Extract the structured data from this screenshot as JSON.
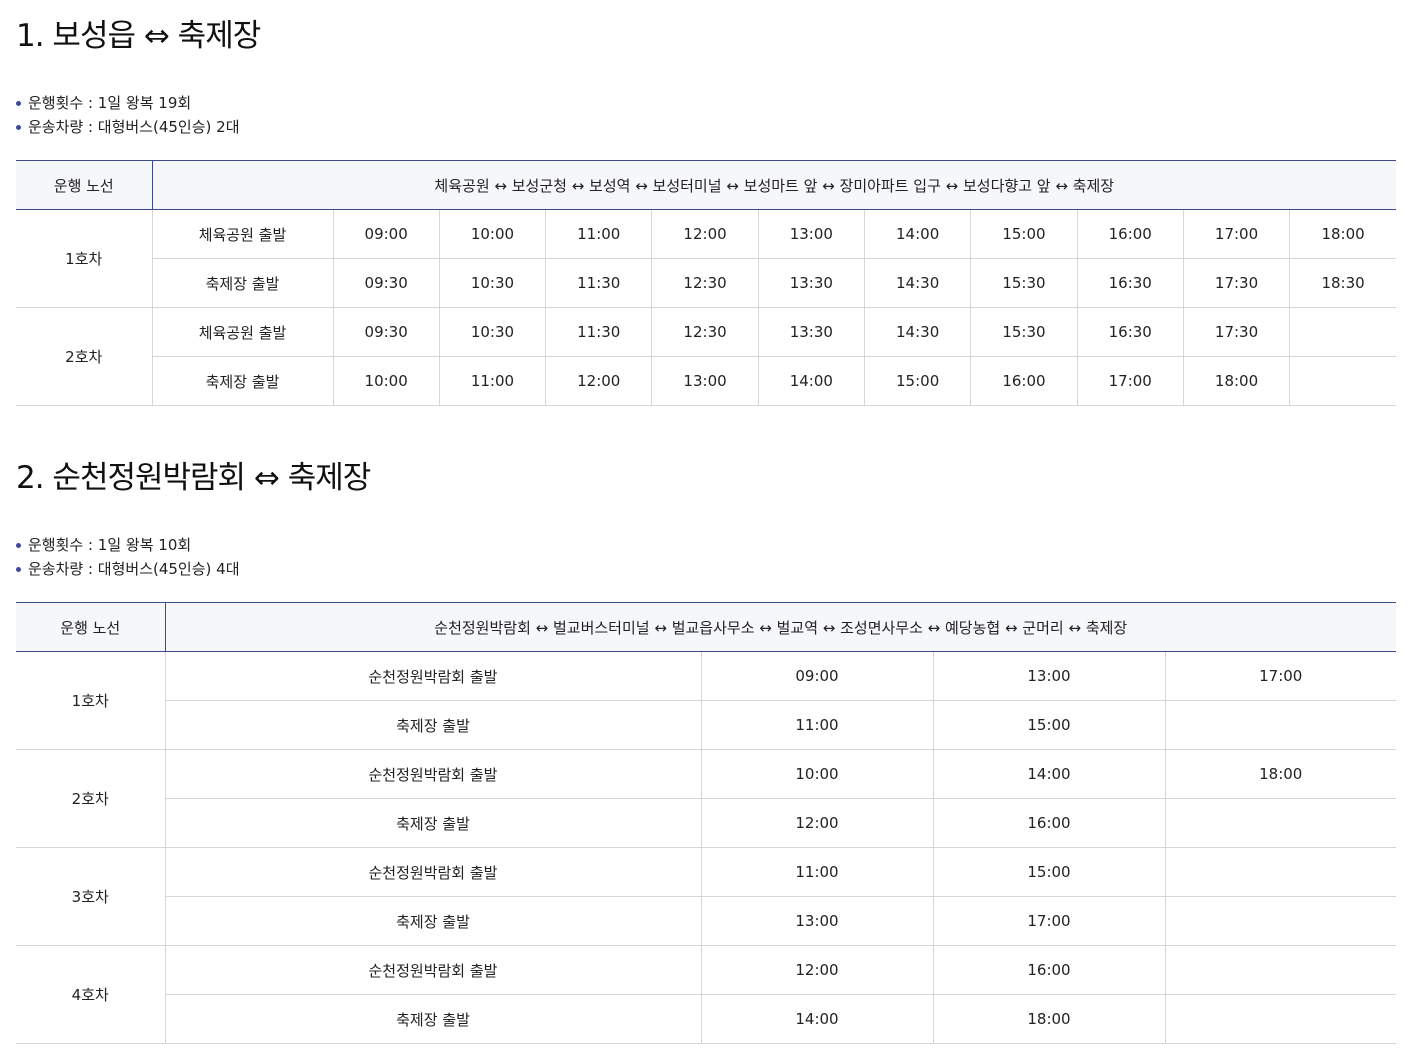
{
  "section1": {
    "title": "1. 보성읍 ⇔ 축제장",
    "info": [
      "운행횟수 : 1일 왕복 19회",
      "운송차량 : 대형버스(45인승) 2대"
    ],
    "header_label": "운행 노선",
    "route": "체육공원 ↔ 보성군청 ↔ 보성역 ↔ 보성터미널 ↔ 보성마트 앞 ↔ 장미아파트 입구 ↔ 보성다향고 앞 ↔ 축제장",
    "cars": [
      {
        "name": "1호차",
        "rows": [
          {
            "label": "체육공원 출발",
            "times": [
              "09:00",
              "10:00",
              "11:00",
              "12:00",
              "13:00",
              "14:00",
              "15:00",
              "16:00",
              "17:00",
              "18:00"
            ]
          },
          {
            "label": "축제장 출발",
            "times": [
              "09:30",
              "10:30",
              "11:30",
              "12:30",
              "13:30",
              "14:30",
              "15:30",
              "16:30",
              "17:30",
              "18:30"
            ]
          }
        ]
      },
      {
        "name": "2호차",
        "rows": [
          {
            "label": "체육공원 출발",
            "times": [
              "09:30",
              "10:30",
              "11:30",
              "12:30",
              "13:30",
              "14:30",
              "15:30",
              "16:30",
              "17:30",
              ""
            ]
          },
          {
            "label": "축제장 출발",
            "times": [
              "10:00",
              "11:00",
              "12:00",
              "13:00",
              "14:00",
              "15:00",
              "16:00",
              "17:00",
              "18:00",
              ""
            ]
          }
        ]
      }
    ]
  },
  "section2": {
    "title": "2. 순천정원박람회 ⇔ 축제장",
    "info": [
      "운행횟수 : 1일 왕복 10회",
      "운송차량 : 대형버스(45인승) 4대"
    ],
    "header_label": "운행 노선",
    "route": "순천정원박람회 ↔ 벌교버스터미널 ↔ 벌교읍사무소 ↔ 벌교역 ↔ 조성면사무소 ↔ 예당농협 ↔ 군머리 ↔ 축제장",
    "cars": [
      {
        "name": "1호차",
        "rows": [
          {
            "label": "순천정원박람회 출발",
            "times": [
              "09:00",
              "13:00",
              "17:00"
            ]
          },
          {
            "label": "축제장 출발",
            "times": [
              "11:00",
              "15:00",
              ""
            ]
          }
        ]
      },
      {
        "name": "2호차",
        "rows": [
          {
            "label": "순천정원박람회 출발",
            "times": [
              "10:00",
              "14:00",
              "18:00"
            ]
          },
          {
            "label": "축제장 출발",
            "times": [
              "12:00",
              "16:00",
              ""
            ]
          }
        ]
      },
      {
        "name": "3호차",
        "rows": [
          {
            "label": "순천정원박람회 출발",
            "times": [
              "11:00",
              "15:00",
              ""
            ]
          },
          {
            "label": "축제장 출발",
            "times": [
              "13:00",
              "17:00",
              ""
            ]
          }
        ]
      },
      {
        "name": "4호차",
        "rows": [
          {
            "label": "순천정원박람회 출발",
            "times": [
              "12:00",
              "16:00",
              ""
            ]
          },
          {
            "label": "축제장 출발",
            "times": [
              "14:00",
              "18:00",
              ""
            ]
          }
        ]
      }
    ]
  }
}
